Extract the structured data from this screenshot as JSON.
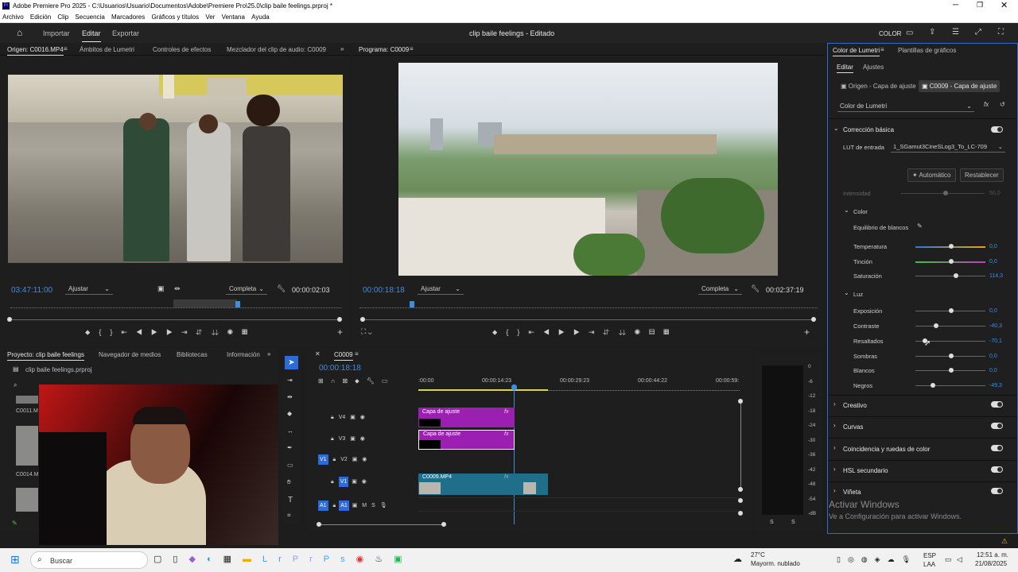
{
  "window": {
    "title": "Adobe Premiere Pro 2025 - C:\\Usuarios\\Usuario\\Documentos\\Adobe\\Premiere Pro\\25.0\\clip baile feelings.prproj *"
  },
  "menu": [
    "Archivo",
    "Edición",
    "Clip",
    "Secuencia",
    "Marcadores",
    "Gráficos y títulos",
    "Ver",
    "Ventana",
    "Ayuda"
  ],
  "header": {
    "importar": "Importar",
    "editar": "Editar",
    "exportar": "Exportar",
    "project_title": "clip baile feelings",
    "status": "- Editado",
    "color": "COLOR"
  },
  "source": {
    "tabs": [
      "Origen: C0016.MP4",
      "Ámbitos de Lumetri",
      "Controles de efectos",
      "Mezclador del clip de audio: C0009"
    ],
    "timecode": "03:47:11:00",
    "fit": "Ajustar",
    "quality": "Completa",
    "duration": "00:00:02:03"
  },
  "program": {
    "tab": "Programa: C0009",
    "timecode": "00:00:18:18",
    "fit": "Ajustar",
    "quality": "Completa",
    "duration": "00:02:37:19"
  },
  "project": {
    "tabs": [
      "Proyecto: clip baile feelings",
      "Navegador de medios",
      "Bibliotecas",
      "Información"
    ],
    "file": "clip baile feelings.prproj",
    "items": [
      "C0011.M",
      "C0014.M"
    ]
  },
  "timeline": {
    "tab": "C0009",
    "timecode": "00:00:18:18",
    "ruler": [
      ":00:00",
      "00:00:14:23",
      "00:00:29:23",
      "00:00:44:22",
      "00:00:59:"
    ],
    "tracks": [
      "V4",
      "V3",
      "V2",
      "V1",
      "A1"
    ],
    "clips": {
      "adj1": "Capa de ajuste",
      "adj2": "Capa de ajuste",
      "v1": "C0009.MP4"
    },
    "fx": "fx"
  },
  "meter": {
    "scale": [
      "0",
      "-6",
      "-12",
      "-18",
      "-24",
      "-30",
      "-36",
      "-42",
      "-48",
      "-54",
      "-dB"
    ],
    "bottom": [
      "S",
      "S"
    ]
  },
  "lumetri": {
    "tabs": [
      "Color de Lumetri",
      "Plantillas de gráficos"
    ],
    "subtabs": [
      "Editar",
      "Ajustes"
    ],
    "origen": "Origen - Capa de ajuste",
    "dest": "C0009 - Capa de ajuste",
    "effect": "Color de Lumetri",
    "basic": "Corrección básica",
    "lut_label": "LUT de entrada",
    "lut": "1_SGamut3CineSLog3_To_LC-709",
    "auto": "Automático",
    "reset": "Restablecer",
    "intensity_label": "Intensidad",
    "intensity": "50,0",
    "color_group": "Color",
    "wb": "Equilibrio de blancos",
    "temperatura_label": "Temperatura",
    "temperatura": "0,0",
    "tincion_label": "Tinción",
    "tincion": "0,0",
    "saturacion_label": "Saturación",
    "saturacion": "114,3",
    "luz": "Luz",
    "exposicion_label": "Exposición",
    "exposicion": "0,0",
    "contraste_label": "Contraste",
    "contraste": "-40,3",
    "resaltados_label": "Resaltados",
    "resaltados": "-70,1",
    "sombras_label": "Sombras",
    "sombras": "0,0",
    "blancos_label": "Blancos",
    "blancos": "0,0",
    "negros_label": "Negros",
    "negros": "-49,3",
    "sections": [
      "Creativo",
      "Curvas",
      "Coincidencia y ruedas de color",
      "HSL secundario",
      "Viñeta"
    ],
    "activate1": "Activar Windows",
    "activate2": "Ve a Configuración para activar Windows."
  },
  "taskbar": {
    "search": "Buscar",
    "weather_temp": "27°C",
    "weather": "Mayorm. nublado",
    "lang1": "ESP",
    "lang2": "LAA",
    "time": "12:51 a. m.",
    "date": "21/08/2025"
  }
}
